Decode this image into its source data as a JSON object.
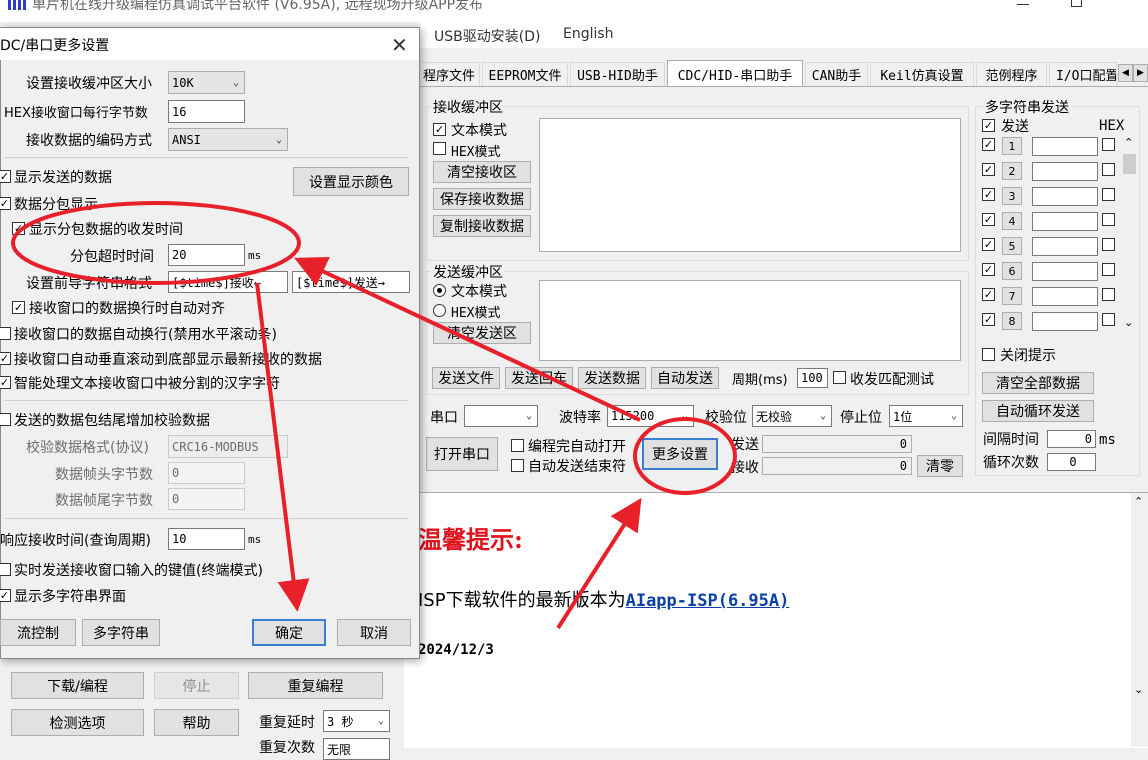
{
  "window": {
    "title": "单片机在线升级编程仿真调试平台软件 (V6.95A), 远程现场升级APP发布"
  },
  "menu": {
    "usb_driver": "USB驱动安装(D)",
    "english": "English"
  },
  "tabs": [
    "程序文件",
    "EEPROM文件",
    "USB-HID助手",
    "CDC/HID-串口助手",
    "CAN助手",
    "Keil仿真设置",
    "范例程序",
    "I/O口配置"
  ],
  "receive": {
    "title": "接收缓冲区",
    "text_mode": "文本模式",
    "hex_mode": "HEX模式",
    "clear": "清空接收区",
    "save": "保存接收数据",
    "copy": "复制接收数据"
  },
  "send": {
    "title": "发送缓冲区",
    "text_mode": "文本模式",
    "hex_mode": "HEX模式",
    "clear": "清空发送区",
    "send_file": "发送文件",
    "send_enter": "发送回车",
    "send_data": "发送数据",
    "auto_send": "自动发送",
    "period_label": "周期(ms)",
    "period_value": "100",
    "match_test": "收发匹配测试"
  },
  "serial": {
    "port_label": "串口",
    "port_value": "",
    "baud_label": "波特率",
    "baud_value": "115200",
    "parity_label": "校验位",
    "parity_value": "无校验",
    "stop_label": "停止位",
    "stop_value": "1位",
    "open": "打开串口",
    "auto_open": "编程完自动打开",
    "auto_end": "自动发送结束符",
    "more_settings": "更多设置",
    "send_label": "发送",
    "send_count": "0",
    "recv_label": "接收",
    "recv_count": "0",
    "clear_count": "清零"
  },
  "multi": {
    "title": "多字符串发送",
    "send_header": "发送",
    "hex_header": "HEX",
    "rows": [
      "1",
      "2",
      "3",
      "4",
      "5",
      "6",
      "7",
      "8"
    ],
    "close_tip": "关闭提示",
    "clear_all": "清空全部数据",
    "auto_loop": "自动循环发送",
    "interval_label": "间隔时间",
    "interval_value": "0",
    "interval_unit": "ms",
    "loop_label": "循环次数",
    "loop_value": "0"
  },
  "info": {
    "tip_title": "温馨提示:",
    "isp_text": "ISP下载软件的最新版本为",
    "isp_link": "AIapp-ISP(6.95A)",
    "date": "2024/12/3"
  },
  "bottom": {
    "download": "下载/编程",
    "stop": "停止",
    "reprogram": "重复编程",
    "detect": "检测选项",
    "help": "帮助",
    "repeat_delay": "重复延时",
    "repeat_delay_value": "3 秒",
    "repeat_count_label": "重复次数",
    "repeat_count_value": "无限"
  },
  "dialog": {
    "title": "DC/串口更多设置",
    "buffer_size_label": "设置接收缓冲区大小",
    "buffer_size_value": "10K",
    "hex_bytes_label": "HEX接收窗口每行字节数",
    "hex_bytes_value": "16",
    "encoding_label": "接收数据的编码方式",
    "encoding_value": "ANSI",
    "show_sent": "显示发送的数据",
    "packet_display": "数据分包显示",
    "show_packet_time": "显示分包数据的收发时间",
    "set_color": "设置显示颜色",
    "packet_timeout_label": "分包超时时间",
    "packet_timeout_value": "20",
    "ms_unit": "ms",
    "prefix_label": "设置前导字符串格式",
    "prefix_recv": "[$time$]接收←",
    "prefix_send": "[$time$]发送→",
    "auto_align": "接收窗口的数据换行时自动对齐",
    "auto_wrap": "接收窗口的数据自动换行(禁用水平滚动条)",
    "auto_scroll": "接收窗口自动垂直滚动到底部显示最新接收的数据",
    "smart_chinese": "智能处理文本接收窗口中被分割的汉字字符",
    "add_checksum": "发送的数据包结尾增加校验数据",
    "check_format_label": "校验数据格式(协议)",
    "check_format_value": "CRC16-MODBUS",
    "frame_head_label": "数据帧头字节数",
    "frame_head_value": "0",
    "frame_tail_label": "数据帧尾字节数",
    "frame_tail_value": "0",
    "response_label": "响应接收时间(查询周期)",
    "response_value": "10",
    "realtime_key": "实时发送接收窗口输入的键值(终端模式)",
    "show_multi": "显示多字符串界面",
    "flow_control": "流控制",
    "multi_string": "多字符串",
    "ok": "确定",
    "cancel": "取消"
  },
  "colors": {
    "annotation_red": "#e8202a",
    "link_blue": "#0a3ea8",
    "tip_red": "#e0131c"
  }
}
